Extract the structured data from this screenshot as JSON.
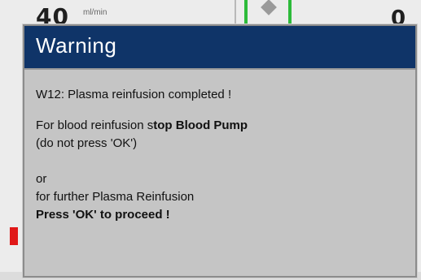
{
  "background": {
    "left_value": "40",
    "left_unit": "ml/min",
    "right_value": "0"
  },
  "dialog": {
    "title": "Warning",
    "message_code": "W12: Plasma reinfusion completed !",
    "instruction_prefix": "For blood reinfusion s",
    "instruction_bold": "top Blood Pump",
    "instruction_note": "(do not press 'OK')",
    "or_text": "or",
    "further_text": "for further Plasma Reinfusion",
    "proceed_text": "Press 'OK' to proceed !"
  },
  "colors": {
    "header_bg": "#0f3468",
    "dialog_bg": "#c5c5c5",
    "pump_indicator": "#2dbb3a",
    "alarm_marker": "#e01818"
  },
  "icons": {
    "pump": "pump-diamond-icon"
  }
}
